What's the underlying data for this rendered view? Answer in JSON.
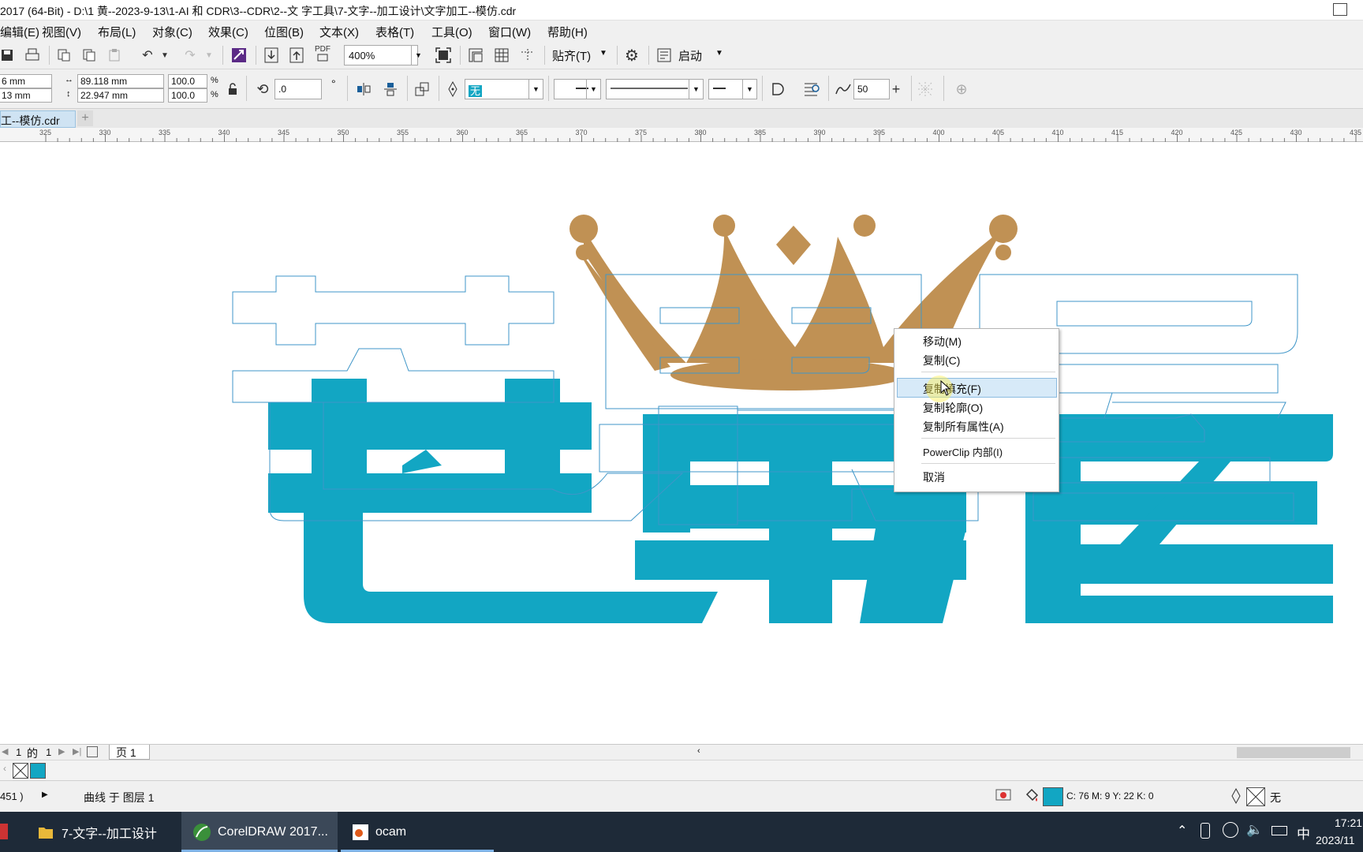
{
  "window": {
    "title": "2017 (64-Bit) - D:\\1 黄--2023-9-13\\1-AI 和 CDR\\3--CDR\\2--文 字工具\\7-文字--加工设计\\文字加工--模仿.cdr"
  },
  "menu": [
    "编辑(E)",
    "视图(V)",
    "布局(L)",
    "对象(C)",
    "效果(C)",
    "位图(B)",
    "文本(X)",
    "表格(T)",
    "工具(O)",
    "窗口(W)",
    "帮助(H)"
  ],
  "toolbar": {
    "zoom": "400%",
    "snap_label": "贴齐(T)",
    "launch_label": "启动",
    "pdf_label": "PDF"
  },
  "property_bar": {
    "x": "6 mm",
    "y": "13 mm",
    "width": "89.118 mm",
    "height": "22.947 mm",
    "scale_x": "100.0",
    "scale_y": "100.0",
    "percent": "%",
    "rotation": ".0",
    "degree": "°",
    "fill": "无",
    "smooth": "50"
  },
  "doc_tab": "工--模仿.cdr",
  "ruler_ticks": [
    "325",
    "330",
    "335",
    "340",
    "345",
    "350",
    "355",
    "360",
    "365",
    "370",
    "375",
    "380",
    "385",
    "390",
    "395",
    "400",
    "405",
    "410",
    "415",
    "420",
    "425",
    "430",
    "435"
  ],
  "context_menu": {
    "items": [
      "移动(M)",
      "复制(C)",
      "复制填充(F)",
      "复制轮廓(O)",
      "复制所有属性(A)",
      "PowerClip 内部(I)",
      "取消"
    ]
  },
  "page_nav": {
    "current": "1",
    "of_label": "的",
    "total": "1",
    "page_tab": "页 1"
  },
  "status": {
    "coords": "451 )",
    "info": "曲线 于 图层 1",
    "fill_cmyk": "C: 76 M: 9 Y: 22 K: 0",
    "outline": "无"
  },
  "taskbar": {
    "items": [
      "7-文字--加工设计",
      "CorelDRAW 2017...",
      "ocam"
    ],
    "time": "17:21",
    "date": "2023/11",
    "ime": "中"
  },
  "colors": {
    "teal": "#12a6c3",
    "gold": "#c09154",
    "outline_blue": "#3f96c8"
  }
}
